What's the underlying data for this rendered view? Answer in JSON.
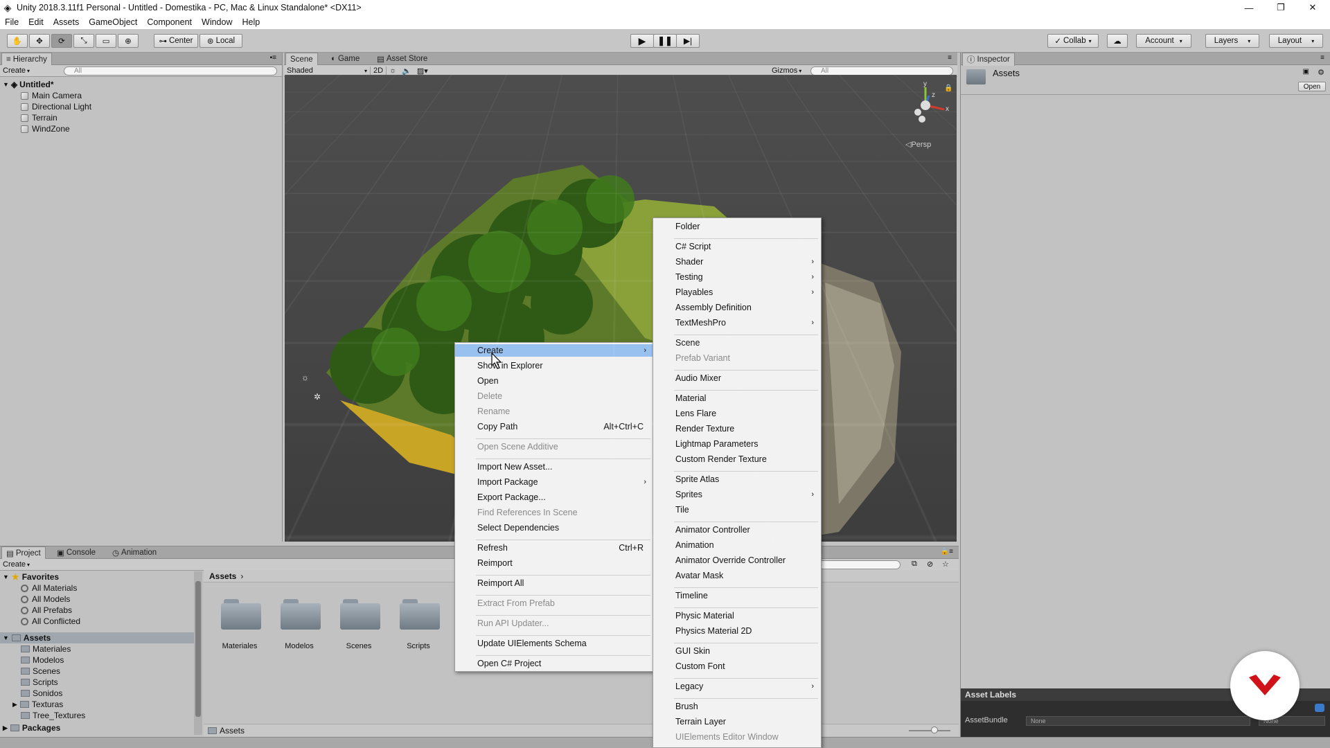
{
  "window": {
    "title": "Unity 2018.3.11f1 Personal - Untitled - Domestika - PC, Mac & Linux Standalone* <DX11>",
    "controls": [
      "minimize",
      "restore",
      "close"
    ]
  },
  "menubar": [
    "File",
    "Edit",
    "Assets",
    "GameObject",
    "Component",
    "Window",
    "Help"
  ],
  "toolbar": {
    "pivot": "Center",
    "space": "Local",
    "collab": "Collab",
    "account": "Account",
    "layers": "Layers",
    "layout": "Layout"
  },
  "hierarchy": {
    "tab": "Hierarchy",
    "create": "Create",
    "search_placeholder": "All",
    "scene": "Untitled*",
    "items": [
      "Main Camera",
      "Directional Light",
      "Terrain",
      "WindZone"
    ]
  },
  "scene_view": {
    "tabs": [
      "Scene",
      "Game",
      "Asset Store"
    ],
    "shading": "Shaded",
    "mode2d": "2D",
    "gizmos": "Gizmos",
    "search_placeholder": "All",
    "persp": "Persp",
    "axes": {
      "x": "x",
      "y": "y",
      "z": "z"
    }
  },
  "inspector": {
    "tab": "Inspector",
    "title": "Assets",
    "open": "Open",
    "asset_labels": "Asset Labels",
    "asset_bundle_label": "AssetBundle",
    "asset_bundle_value": "None",
    "asset_bundle_variant": "None"
  },
  "project": {
    "tabs": [
      "Project",
      "Console",
      "Animation"
    ],
    "create": "Create",
    "favorites_title": "Favorites",
    "favorites": [
      "All Materials",
      "All Models",
      "All Prefabs",
      "All Conflicted"
    ],
    "assets_title": "Assets",
    "assets_tree": [
      "Materiales",
      "Modelos",
      "Scenes",
      "Scripts",
      "Sonidos",
      "Texturas",
      "Tree_Textures"
    ],
    "packages": "Packages",
    "breadcrumb": "Assets",
    "folders": [
      "Materiales",
      "Modelos",
      "Scenes",
      "Scripts"
    ],
    "footer_path": "Assets"
  },
  "context_menu": {
    "items": [
      {
        "label": "Create",
        "highlight": true,
        "submenu": true
      },
      {
        "label": "Show in Explorer"
      },
      {
        "label": "Open"
      },
      {
        "label": "Delete",
        "disabled": true
      },
      {
        "label": "Rename",
        "disabled": true
      },
      {
        "label": "Copy Path",
        "shortcut": "Alt+Ctrl+C"
      },
      {
        "sep": true
      },
      {
        "label": "Open Scene Additive",
        "disabled": true
      },
      {
        "sep": true
      },
      {
        "label": "Import New Asset..."
      },
      {
        "label": "Import Package",
        "submenu": true
      },
      {
        "label": "Export Package..."
      },
      {
        "label": "Find References In Scene",
        "disabled": true
      },
      {
        "label": "Select Dependencies"
      },
      {
        "sep": true
      },
      {
        "label": "Refresh",
        "shortcut": "Ctrl+R"
      },
      {
        "label": "Reimport"
      },
      {
        "sep": true
      },
      {
        "label": "Reimport All"
      },
      {
        "sep": true
      },
      {
        "label": "Extract From Prefab",
        "disabled": true
      },
      {
        "sep": true
      },
      {
        "label": "Run API Updater...",
        "disabled": true
      },
      {
        "sep": true
      },
      {
        "label": "Update UIElements Schema"
      },
      {
        "sep": true
      },
      {
        "label": "Open C# Project"
      }
    ]
  },
  "create_submenu": {
    "items": [
      {
        "label": "Folder"
      },
      {
        "sep": true
      },
      {
        "label": "C# Script"
      },
      {
        "label": "Shader",
        "submenu": true
      },
      {
        "label": "Testing",
        "submenu": true
      },
      {
        "label": "Playables",
        "submenu": true
      },
      {
        "label": "Assembly Definition"
      },
      {
        "label": "TextMeshPro",
        "submenu": true
      },
      {
        "sep": true
      },
      {
        "label": "Scene"
      },
      {
        "label": "Prefab Variant",
        "disabled": true
      },
      {
        "sep": true
      },
      {
        "label": "Audio Mixer"
      },
      {
        "sep": true
      },
      {
        "label": "Material"
      },
      {
        "label": "Lens Flare"
      },
      {
        "label": "Render Texture"
      },
      {
        "label": "Lightmap Parameters"
      },
      {
        "label": "Custom Render Texture"
      },
      {
        "sep": true
      },
      {
        "label": "Sprite Atlas"
      },
      {
        "label": "Sprites",
        "submenu": true
      },
      {
        "label": "Tile"
      },
      {
        "sep": true
      },
      {
        "label": "Animator Controller"
      },
      {
        "label": "Animation"
      },
      {
        "label": "Animator Override Controller"
      },
      {
        "label": "Avatar Mask"
      },
      {
        "sep": true
      },
      {
        "label": "Timeline"
      },
      {
        "sep": true
      },
      {
        "label": "Physic Material"
      },
      {
        "label": "Physics Material 2D"
      },
      {
        "sep": true
      },
      {
        "label": "GUI Skin"
      },
      {
        "label": "Custom Font"
      },
      {
        "sep": true
      },
      {
        "label": "Legacy",
        "submenu": true
      },
      {
        "sep": true
      },
      {
        "label": "Brush"
      },
      {
        "label": "Terrain Layer"
      },
      {
        "label": "UIElements Editor Window",
        "disabled": true
      }
    ]
  },
  "colors": {
    "menu_highlight": "#98c1f0",
    "watermark": "#d0121b"
  }
}
